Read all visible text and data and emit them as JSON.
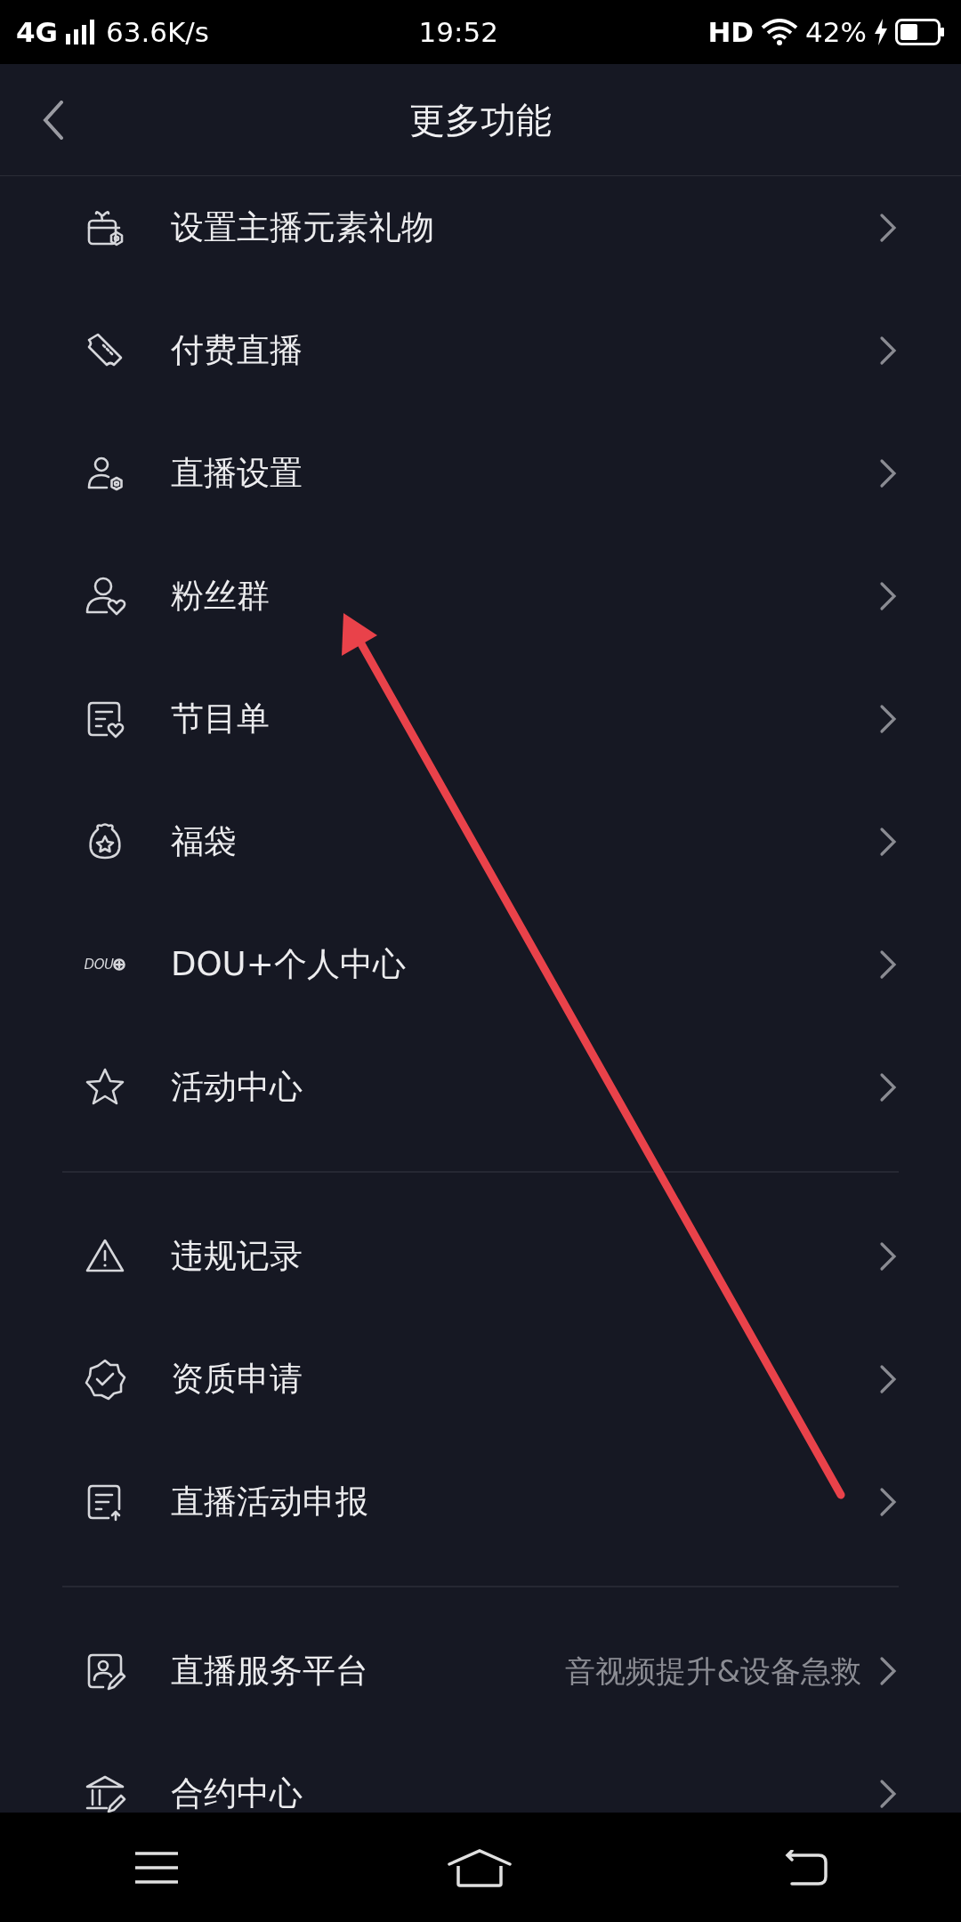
{
  "status_bar": {
    "network": "4G",
    "speed": "63.6K/s",
    "time": "19:52",
    "quality": "HD",
    "battery": "42%"
  },
  "header": {
    "title": "更多功能"
  },
  "sections": [
    {
      "items": [
        {
          "label": "设置主播元素礼物"
        },
        {
          "label": "付费直播"
        },
        {
          "label": "直播设置"
        },
        {
          "label": "粉丝群"
        },
        {
          "label": "节目单"
        },
        {
          "label": "福袋"
        },
        {
          "icon_text": "DOU",
          "label": "DOU+个人中心"
        },
        {
          "label": "活动中心"
        }
      ]
    },
    {
      "items": [
        {
          "label": "违规记录"
        },
        {
          "label": "资质申请"
        },
        {
          "label": "直播活动申报"
        }
      ]
    },
    {
      "items": [
        {
          "label": "直播服务平台",
          "detail": "音视频提升&设备急救"
        },
        {
          "label": "合约中心"
        }
      ]
    }
  ],
  "annotation": {
    "kind": "arrow"
  }
}
